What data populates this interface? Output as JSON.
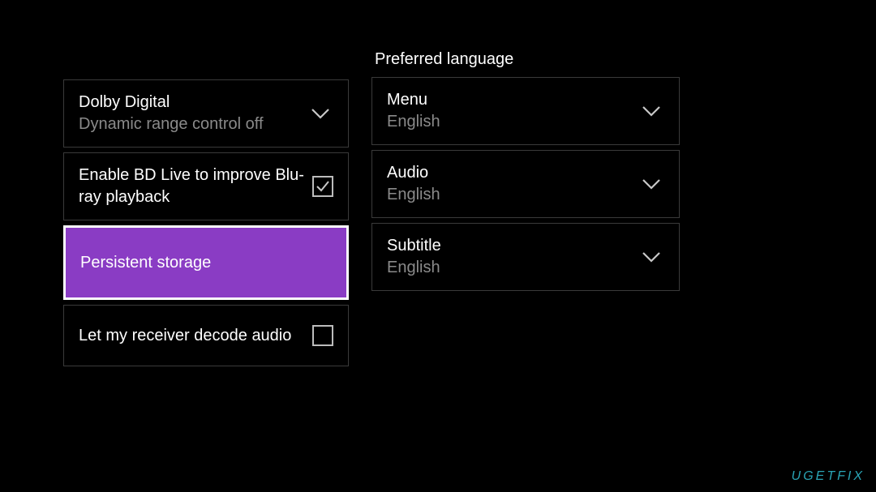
{
  "left_col": {
    "dolby": {
      "title": "Dolby Digital",
      "subtitle": "Dynamic range control off"
    },
    "bdlive": {
      "title": "Enable BD Live to improve Blu-ray playback",
      "checked": true
    },
    "persistent": {
      "title": "Persistent storage"
    },
    "receiver": {
      "title": "Let my receiver decode audio",
      "checked": false
    }
  },
  "right_col": {
    "section_title": "Preferred language",
    "menu": {
      "title": "Menu",
      "value": "English"
    },
    "audio": {
      "title": "Audio",
      "value": "English"
    },
    "subtitle": {
      "title": "Subtitle",
      "value": "English"
    }
  },
  "watermark": "UGETFIX"
}
